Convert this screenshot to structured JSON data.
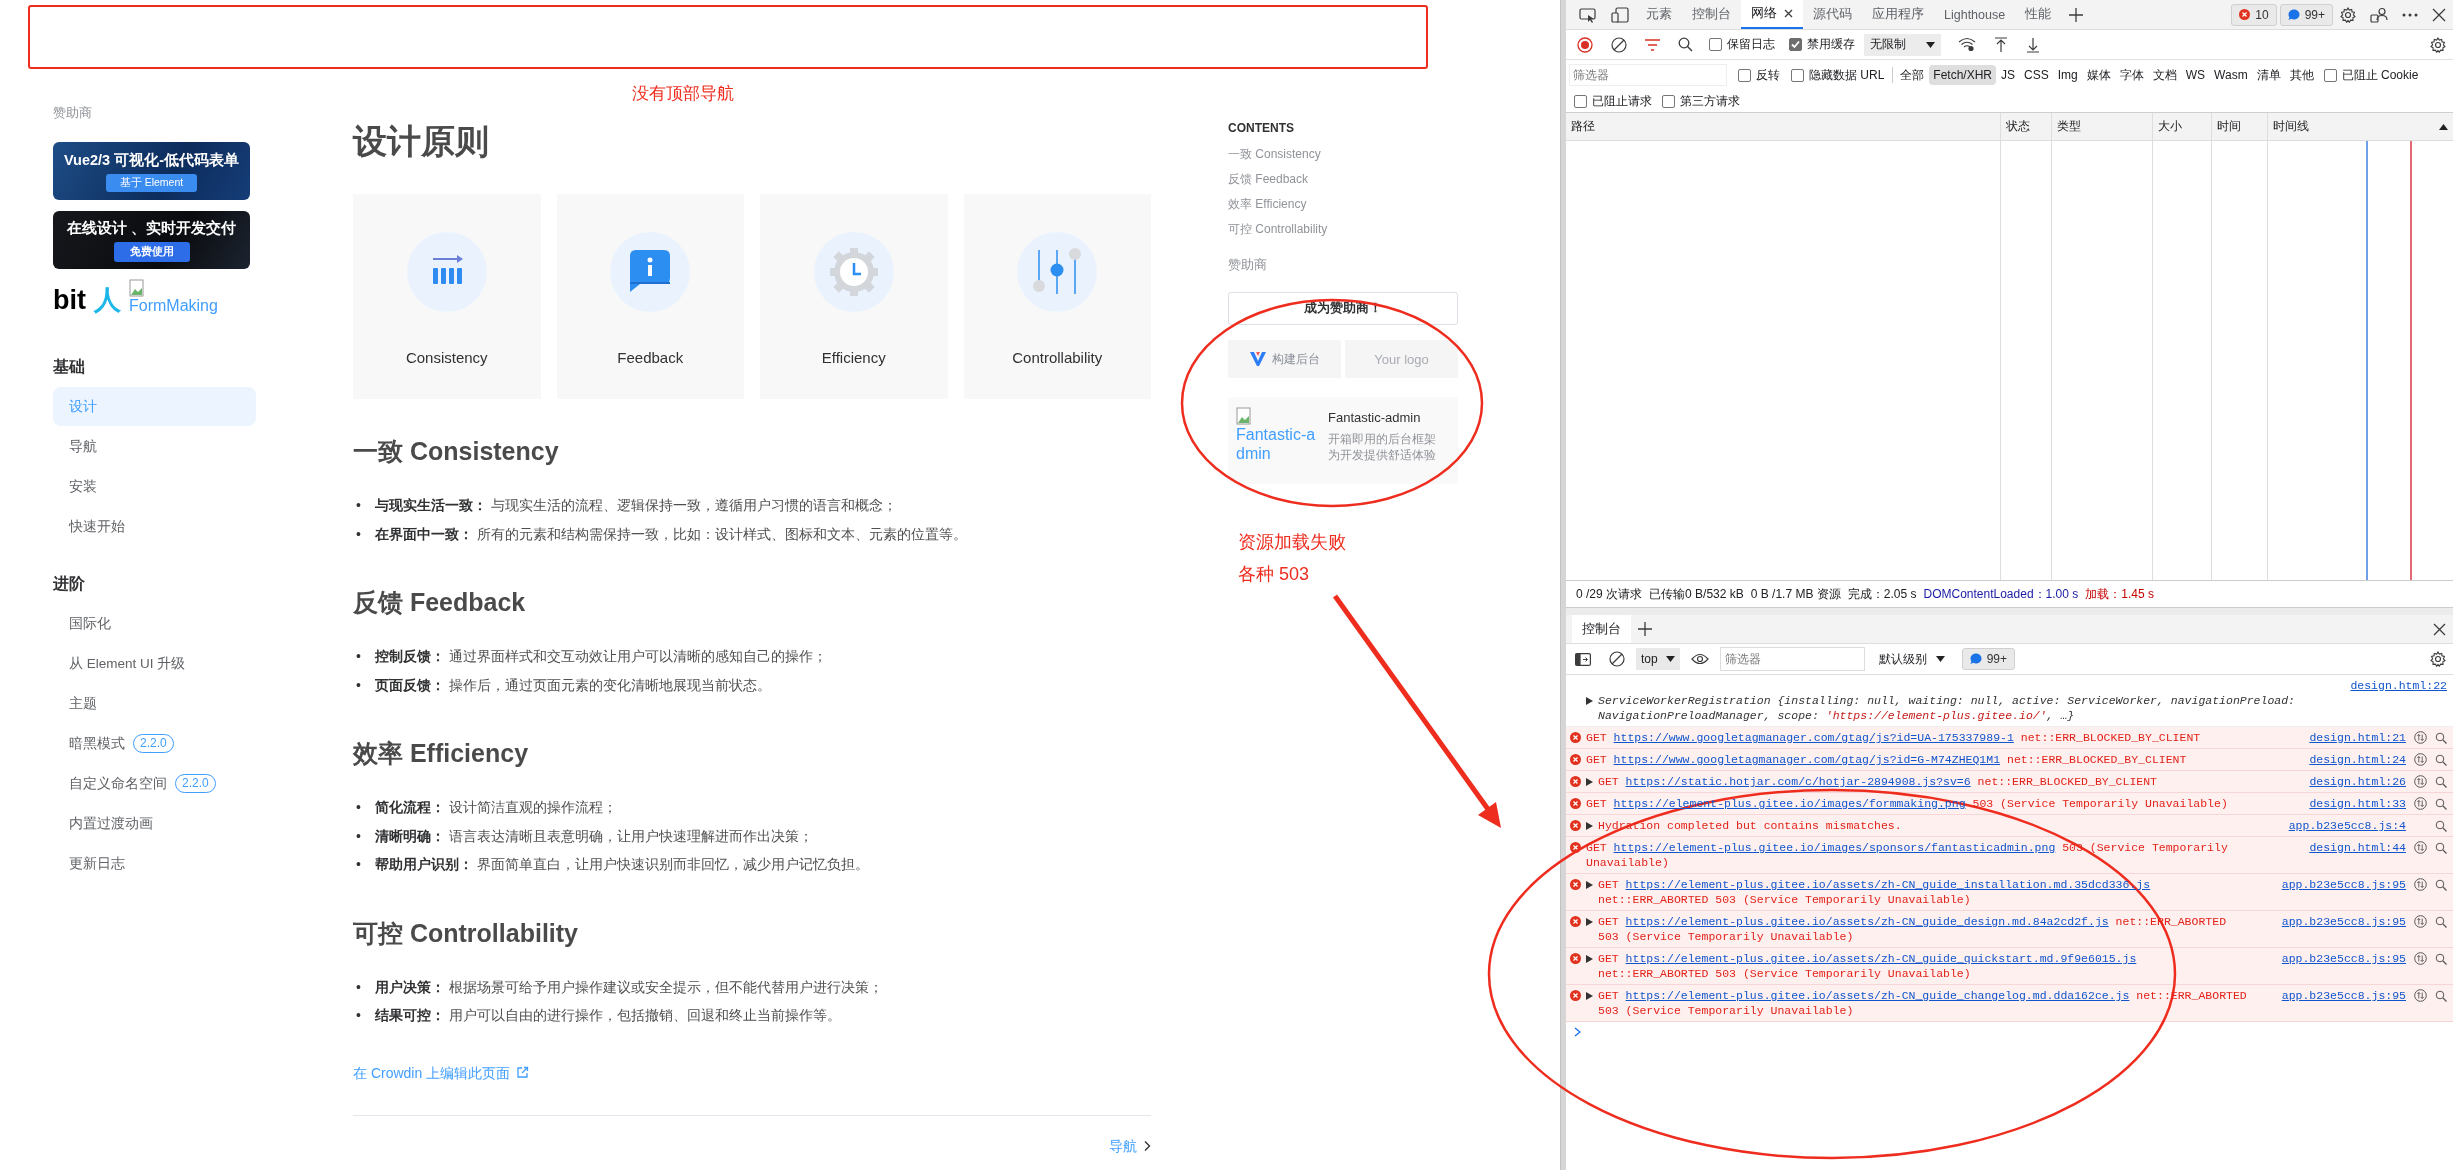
{
  "annotations": {
    "top_note": "没有顶部导航",
    "side_notes": [
      "资源加载失败",
      "各种 503"
    ]
  },
  "sidebar": {
    "sponsor_title": "赞助商",
    "banners": [
      {
        "kind": "form",
        "title": "Vue2/3 可视化-低代码表单",
        "button": "基于 Element"
      },
      {
        "kind": "dev",
        "title": "在线设计 、实时开发交付",
        "button": "免费使用"
      }
    ],
    "logo_text": "bit",
    "logo_mark": "人",
    "broken_image_alt": "FormMaking",
    "groups": [
      {
        "title": "基础",
        "items": [
          {
            "label": "设计",
            "selected": true
          },
          {
            "label": "导航",
            "selected": false
          },
          {
            "label": "安装",
            "selected": false
          },
          {
            "label": "快速开始",
            "selected": false
          }
        ]
      },
      {
        "title": "进阶",
        "items": [
          {
            "label": "国际化",
            "selected": false
          },
          {
            "label": "从 Element UI 升级",
            "selected": false
          },
          {
            "label": "主题",
            "selected": false
          },
          {
            "label": "暗黑模式",
            "selected": false,
            "badge": "2.2.0"
          },
          {
            "label": "自定义命名空间",
            "selected": false,
            "badge": "2.2.0"
          },
          {
            "label": "内置过渡动画",
            "selected": false
          },
          {
            "label": "更新日志",
            "selected": false
          }
        ]
      }
    ]
  },
  "main": {
    "title": "设计原则",
    "cards": [
      {
        "kind": "consistency",
        "label": "Consistency"
      },
      {
        "kind": "feedback",
        "label": "Feedback"
      },
      {
        "kind": "efficiency",
        "label": "Efficiency"
      },
      {
        "kind": "controllability",
        "label": "Controllability"
      }
    ],
    "sections": [
      {
        "heading": "一致 Consistency",
        "bullets": [
          "**与现实生活一致：** 与现实生活的流程、逻辑保持一致，遵循用户习惯的语言和概念；",
          "**在界面中一致：** 所有的元素和结构需保持一致，比如：设计样式、图标和文本、元素的位置等。"
        ]
      },
      {
        "heading": "反馈 Feedback",
        "bullets": [
          "**控制反馈：** 通过界面样式和交互动效让用户可以清晰的感知自己的操作；",
          "**页面反馈：** 操作后，通过页面元素的变化清晰地展现当前状态。"
        ]
      },
      {
        "heading": "效率 Efficiency",
        "bullets": [
          "**简化流程：** 设计简洁直观的操作流程；",
          "**清晰明确：** 语言表达清晰且表意明确，让用户快速理解进而作出决策；",
          "**帮助用户识别：** 界面简单直白，让用户快速识别而非回忆，减少用户记忆负担。"
        ]
      },
      {
        "heading": "可控 Controllability",
        "bullets": [
          "**用户决策：** 根据场景可给予用户操作建议或安全提示，但不能代替用户进行决策；",
          "**结果可控：** 用户可以自由的进行操作，包括撤销、回退和终止当前操作等。"
        ]
      }
    ],
    "bullet_marker": "•",
    "edit_link": "在 Crowdin 上编辑此页面",
    "next_link": "导航"
  },
  "aside": {
    "contents_title": "CONTENTS",
    "contents": [
      "一致 Consistency",
      "反馈 Feedback",
      "效率 Efficiency",
      "可控 Controllability"
    ],
    "sponsor_title": "赞助商",
    "become_sponsor": "成为赞助商！",
    "logos": [
      {
        "kind": "brand",
        "text": "构建后台"
      },
      {
        "kind": "placeholder",
        "text": "Your logo"
      }
    ],
    "card": {
      "alt": "Fantastic-admin",
      "title": "Fantastic-admin",
      "lines": [
        "开箱即用的后台框架",
        "为开发提供舒适体验"
      ]
    }
  },
  "devtools": {
    "tabs": [
      {
        "label": "元素",
        "selected": false
      },
      {
        "label": "控制台",
        "selected": false
      },
      {
        "label": "网络",
        "selected": true,
        "closable": true
      },
      {
        "label": "源代码",
        "selected": false
      },
      {
        "label": "应用程序",
        "selected": false
      },
      {
        "label": "Lighthouse",
        "selected": false
      },
      {
        "label": "性能",
        "selected": false
      }
    ],
    "error_badge": "10",
    "message_badge": "99+",
    "network": {
      "toggles": [
        {
          "label": "保留日志",
          "checked": false
        },
        {
          "label": "禁用缓存",
          "checked": true
        }
      ],
      "throttle": "无限制",
      "filter_placeholder": "筛选器",
      "filter_toggles": [
        {
          "label": "反转",
          "checked": false
        },
        {
          "label": "隐藏数据 URL",
          "checked": false
        }
      ],
      "types": [
        {
          "label": "全部",
          "selected": false
        },
        {
          "label": "Fetch/XHR",
          "selected": true
        },
        {
          "label": "JS",
          "selected": false
        },
        {
          "label": "CSS",
          "selected": false
        },
        {
          "label": "Img",
          "selected": false
        },
        {
          "label": "媒体",
          "selected": false
        },
        {
          "label": "字体",
          "selected": false
        },
        {
          "label": "文档",
          "selected": false
        },
        {
          "label": "WS",
          "selected": false
        },
        {
          "label": "Wasm",
          "selected": false
        },
        {
          "label": "清单",
          "selected": false
        },
        {
          "label": "其他",
          "selected": false
        }
      ],
      "cookie_toggle": {
        "label": "已阻止 Cookie",
        "checked": false
      },
      "request_toggles": [
        {
          "label": "已阻止请求",
          "checked": false
        },
        {
          "label": "第三方请求",
          "checked": false
        }
      ],
      "columns": [
        "路径",
        "状态",
        "类型",
        "大小",
        "时间",
        "时间线"
      ],
      "summary": [
        {
          "kind": "plain",
          "text": "0 /29 次请求"
        },
        {
          "kind": "plain",
          "text": "已传输0 B/532 kB"
        },
        {
          "kind": "plain",
          "text": "0 B /1.7 MB 资源"
        },
        {
          "kind": "plain",
          "text": "完成：2.05 s"
        },
        {
          "kind": "dom",
          "text": "DOMContentLoaded：1.00 s"
        },
        {
          "kind": "load",
          "text": "加载：1.45 s"
        }
      ]
    },
    "console": {
      "tab": "控制台",
      "context": "top",
      "filter_placeholder": "筛选器",
      "level": "默认级别",
      "badge": "99+",
      "messages": [
        {
          "kind": "log",
          "expandable": true,
          "source": "design.html:22",
          "parts": [
            {
              "kind": "plain",
              "text": "ServiceWorkerRegistration {installing: null, waiting: null, active: ServiceWorker, navigationPreload: NavigationPreloadManager, scope: "
            },
            {
              "kind": "string",
              "text": "'https://element-plus.gitee.io/'"
            },
            {
              "kind": "plain",
              "text": ", …}"
            }
          ]
        },
        {
          "kind": "error",
          "expandable": false,
          "network": true,
          "method": "GET",
          "url": "https://www.googletagmanager.com/gtag/js?id=UA-175337989-1",
          "text": "net::ERR_BLOCKED_BY_CLIENT",
          "source": "design.html:21"
        },
        {
          "kind": "error",
          "expandable": false,
          "network": true,
          "method": "GET",
          "url": "https://www.googletagmanager.com/gtag/js?id=G-M74ZHEQ1M1",
          "text": "net::ERR_BLOCKED_BY_CLIENT",
          "source": "design.html:24"
        },
        {
          "kind": "error",
          "expandable": true,
          "network": true,
          "method": "GET",
          "url": "https://static.hotjar.com/c/hotjar-2894908.js?sv=6",
          "text": "net::ERR_BLOCKED_BY_CLIENT",
          "source": "design.html:26"
        },
        {
          "kind": "error",
          "expandable": false,
          "network": true,
          "method": "GET",
          "url": "https://element-plus.gitee.io/images/formmaking.png",
          "text": "503 (Service Temporarily Unavailable)",
          "source": "design.html:33"
        },
        {
          "kind": "error",
          "expandable": true,
          "network": false,
          "text": "Hydration completed but contains mismatches.",
          "source": "app.b23e5cc8.js:4"
        },
        {
          "kind": "error",
          "expandable": false,
          "network": true,
          "method": "GET",
          "url": "https://element-plus.gitee.io/images/sponsors/fantasticadmin.png",
          "text": "503 (Service Temporarily Unavailable)",
          "source": "design.html:44"
        },
        {
          "kind": "error",
          "expandable": true,
          "network": true,
          "method": "GET",
          "url": "https://element-plus.gitee.io/assets/zh-CN_guide_installation.md.35dcd336.js",
          "text": "net::ERR_ABORTED 503 (Service Temporarily Unavailable)",
          "source": "app.b23e5cc8.js:95"
        },
        {
          "kind": "error",
          "expandable": true,
          "network": true,
          "method": "GET",
          "url": "https://element-plus.gitee.io/assets/zh-CN_guide_design.md.84a2cd2f.js",
          "text": "net::ERR_ABORTED 503 (Service Temporarily Unavailable)",
          "source": "app.b23e5cc8.js:95"
        },
        {
          "kind": "error",
          "expandable": true,
          "network": true,
          "method": "GET",
          "url": "https://element-plus.gitee.io/assets/zh-CN_guide_quickstart.md.9f9e6015.js",
          "text": "net::ERR_ABORTED 503 (Service Temporarily Unavailable)",
          "source": "app.b23e5cc8.js:95"
        },
        {
          "kind": "error",
          "expandable": true,
          "network": true,
          "method": "GET",
          "url": "https://element-plus.gitee.io/assets/zh-CN_guide_changelog.md.dda162ce.js",
          "text": "net::ERR_ABORTED 503 (Service Temporarily Unavailable)",
          "source": "app.b23e5cc8.js:95"
        }
      ]
    }
  }
}
